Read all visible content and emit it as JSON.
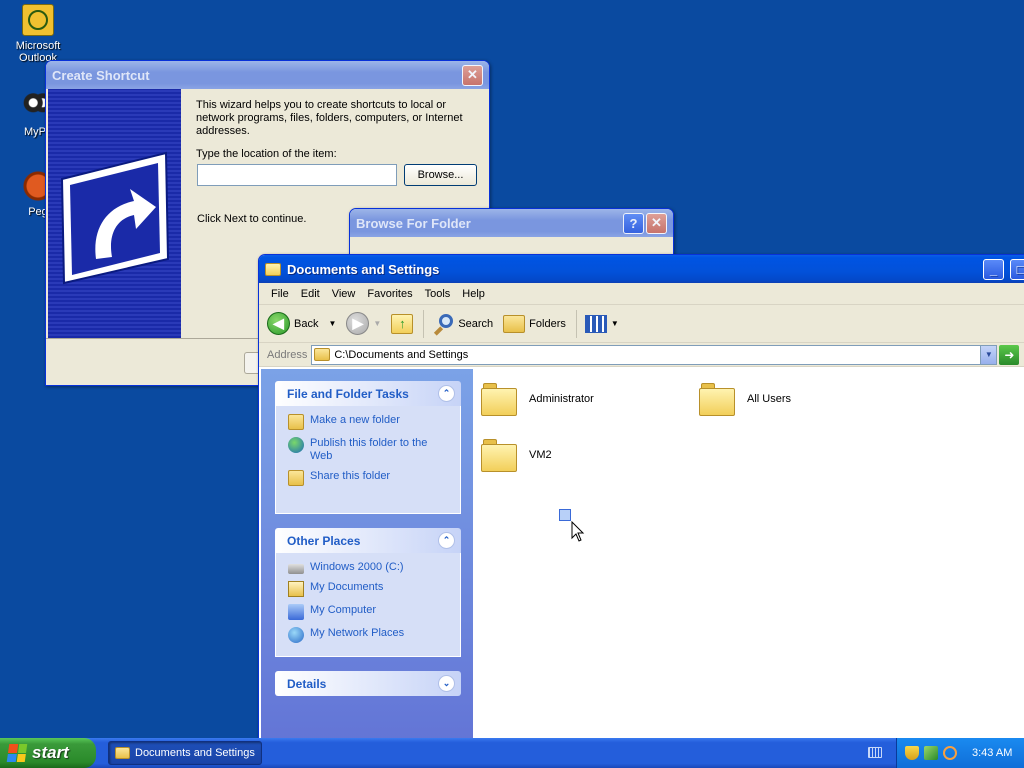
{
  "desktop": {
    "icons": [
      {
        "label": "Microsoft Outlook"
      },
      {
        "label": "MyPa"
      },
      {
        "label": "Peg"
      }
    ]
  },
  "create_shortcut": {
    "title": "Create Shortcut",
    "intro": "This wizard helps you to create shortcuts to local or network programs, files, folders, computers, or Internet addresses.",
    "location_label": "Type the location of the item:",
    "location_value": "",
    "browse_button": "Browse...",
    "next_hint": "Click Next to continue."
  },
  "browse_folder": {
    "title": "Browse For Folder",
    "help_label": "?",
    "close_label": "✕"
  },
  "explorer": {
    "title": "Documents and Settings",
    "menu": [
      "File",
      "Edit",
      "View",
      "Favorites",
      "Tools",
      "Help"
    ],
    "toolbar": {
      "back": "Back",
      "search": "Search",
      "folders": "Folders"
    },
    "address_label": "Address",
    "address_value": "C:\\Documents and Settings",
    "file_tasks": {
      "title": "File and Folder Tasks",
      "items": [
        "Make a new folder",
        "Publish this folder to the Web",
        "Share this folder"
      ]
    },
    "other_places": {
      "title": "Other Places",
      "items": [
        "Windows 2000 (C:)",
        "My Documents",
        "My Computer",
        "My Network Places"
      ]
    },
    "details": {
      "title": "Details"
    },
    "folders": [
      "Administrator",
      "All Users",
      "VM2"
    ]
  },
  "taskbar": {
    "start_label": "start",
    "task_button": "Documents and Settings",
    "clock": "3:43 AM"
  }
}
